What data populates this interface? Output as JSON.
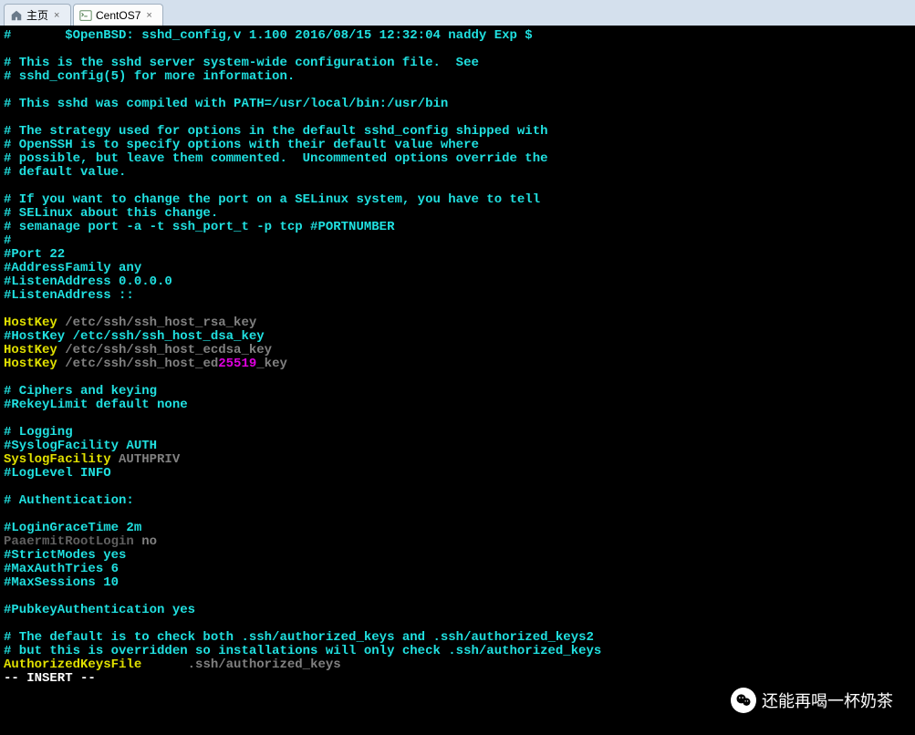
{
  "tabs": [
    {
      "label": "主页",
      "icon": "home"
    },
    {
      "label": "CentOS7",
      "icon": "terminal"
    }
  ],
  "watermark": "还能再喝一杯奶茶",
  "terminal": {
    "lines": [
      {
        "spans": [
          {
            "t": "#       $OpenBSD: sshd_config,v 1.100 2016/08/15 12:32:04 naddy Exp $",
            "c": "cyan"
          }
        ]
      },
      {
        "spans": [
          {
            "t": "",
            "c": "cyan"
          }
        ]
      },
      {
        "spans": [
          {
            "t": "# This is the sshd server system-wide configuration file.  See",
            "c": "cyan"
          }
        ]
      },
      {
        "spans": [
          {
            "t": "# sshd_config(5) for more information.",
            "c": "cyan"
          }
        ]
      },
      {
        "spans": [
          {
            "t": "",
            "c": "cyan"
          }
        ]
      },
      {
        "spans": [
          {
            "t": "# This sshd was compiled with PATH=/usr/local/bin:/usr/bin",
            "c": "cyan"
          }
        ]
      },
      {
        "spans": [
          {
            "t": "",
            "c": "cyan"
          }
        ]
      },
      {
        "spans": [
          {
            "t": "# The strategy used for options in the default sshd_config shipped with",
            "c": "cyan"
          }
        ]
      },
      {
        "spans": [
          {
            "t": "# OpenSSH is to specify options with their default value where",
            "c": "cyan"
          }
        ]
      },
      {
        "spans": [
          {
            "t": "# possible, but leave them commented.  Uncommented options override the",
            "c": "cyan"
          }
        ]
      },
      {
        "spans": [
          {
            "t": "# default value.",
            "c": "cyan"
          }
        ]
      },
      {
        "spans": [
          {
            "t": "",
            "c": "cyan"
          }
        ]
      },
      {
        "spans": [
          {
            "t": "# If you want to change the port on a SELinux system, you have to tell",
            "c": "cyan"
          }
        ]
      },
      {
        "spans": [
          {
            "t": "# SELinux about this change.",
            "c": "cyan"
          }
        ]
      },
      {
        "spans": [
          {
            "t": "# semanage port -a -t ssh_port_t -p tcp #PORTNUMBER",
            "c": "cyan"
          }
        ]
      },
      {
        "spans": [
          {
            "t": "#",
            "c": "cyan"
          }
        ]
      },
      {
        "spans": [
          {
            "t": "#Port 22",
            "c": "cyan"
          }
        ]
      },
      {
        "spans": [
          {
            "t": "#AddressFamily any",
            "c": "cyan"
          }
        ]
      },
      {
        "spans": [
          {
            "t": "#ListenAddress 0.0.0.0",
            "c": "cyan"
          }
        ]
      },
      {
        "spans": [
          {
            "t": "#ListenAddress ::",
            "c": "cyan"
          }
        ]
      },
      {
        "spans": [
          {
            "t": "",
            "c": "cyan"
          }
        ]
      },
      {
        "spans": [
          {
            "t": "HostKey",
            "c": "yellow"
          },
          {
            "t": " /etc/ssh/ssh_host_rsa_key",
            "c": "gray"
          }
        ]
      },
      {
        "spans": [
          {
            "t": "#HostKey /etc/ssh/ssh_host_dsa_key",
            "c": "cyan"
          }
        ]
      },
      {
        "spans": [
          {
            "t": "HostKey",
            "c": "yellow"
          },
          {
            "t": " /etc/ssh/ssh_host_ecdsa_key",
            "c": "gray"
          }
        ]
      },
      {
        "spans": [
          {
            "t": "HostKey",
            "c": "yellow"
          },
          {
            "t": " /etc/ssh/ssh_host_ed",
            "c": "gray"
          },
          {
            "t": "25519",
            "c": "magenta"
          },
          {
            "t": "_key",
            "c": "gray"
          }
        ]
      },
      {
        "spans": [
          {
            "t": "",
            "c": "cyan"
          }
        ]
      },
      {
        "spans": [
          {
            "t": "# Ciphers and keying",
            "c": "cyan"
          }
        ]
      },
      {
        "spans": [
          {
            "t": "#RekeyLimit default none",
            "c": "cyan"
          }
        ]
      },
      {
        "spans": [
          {
            "t": "",
            "c": "cyan"
          }
        ]
      },
      {
        "spans": [
          {
            "t": "# Logging",
            "c": "cyan"
          }
        ]
      },
      {
        "spans": [
          {
            "t": "#SyslogFacility AUTH",
            "c": "cyan"
          }
        ]
      },
      {
        "spans": [
          {
            "t": "SyslogFacility",
            "c": "yellow"
          },
          {
            "t": " AUTHPRIV",
            "c": "gray"
          }
        ]
      },
      {
        "spans": [
          {
            "t": "#LogLevel INFO",
            "c": "cyan"
          }
        ]
      },
      {
        "spans": [
          {
            "t": "",
            "c": "cyan"
          }
        ]
      },
      {
        "spans": [
          {
            "t": "# Authentication:",
            "c": "cyan"
          }
        ]
      },
      {
        "spans": [
          {
            "t": "",
            "c": "cyan"
          }
        ]
      },
      {
        "spans": [
          {
            "t": "#LoginGraceTime 2m",
            "c": "cyan"
          }
        ]
      },
      {
        "spans": [
          {
            "t": "PaaermitRootLogin",
            "c": "darkgray"
          },
          {
            "t": " no",
            "c": "gray"
          }
        ]
      },
      {
        "spans": [
          {
            "t": "#StrictModes yes",
            "c": "cyan"
          }
        ]
      },
      {
        "spans": [
          {
            "t": "#MaxAuthTries 6",
            "c": "cyan"
          }
        ]
      },
      {
        "spans": [
          {
            "t": "#MaxSessions 10",
            "c": "cyan"
          }
        ]
      },
      {
        "spans": [
          {
            "t": "",
            "c": "cyan"
          }
        ]
      },
      {
        "spans": [
          {
            "t": "#PubkeyAuthentication yes",
            "c": "cyan"
          }
        ]
      },
      {
        "spans": [
          {
            "t": "",
            "c": "cyan"
          }
        ]
      },
      {
        "spans": [
          {
            "t": "# The default is to check both .ssh/authorized_keys and .ssh/authorized_keys2",
            "c": "cyan"
          }
        ]
      },
      {
        "spans": [
          {
            "t": "# but this is overridden so installations will only check .ssh/authorized_keys",
            "c": "cyan"
          }
        ]
      },
      {
        "spans": [
          {
            "t": "AuthorizedKeysFile",
            "c": "yellow"
          },
          {
            "t": "      .ssh/authorized_keys",
            "c": "gray"
          }
        ]
      },
      {
        "spans": [
          {
            "t": "-- INSERT --",
            "c": "white"
          }
        ]
      }
    ]
  }
}
